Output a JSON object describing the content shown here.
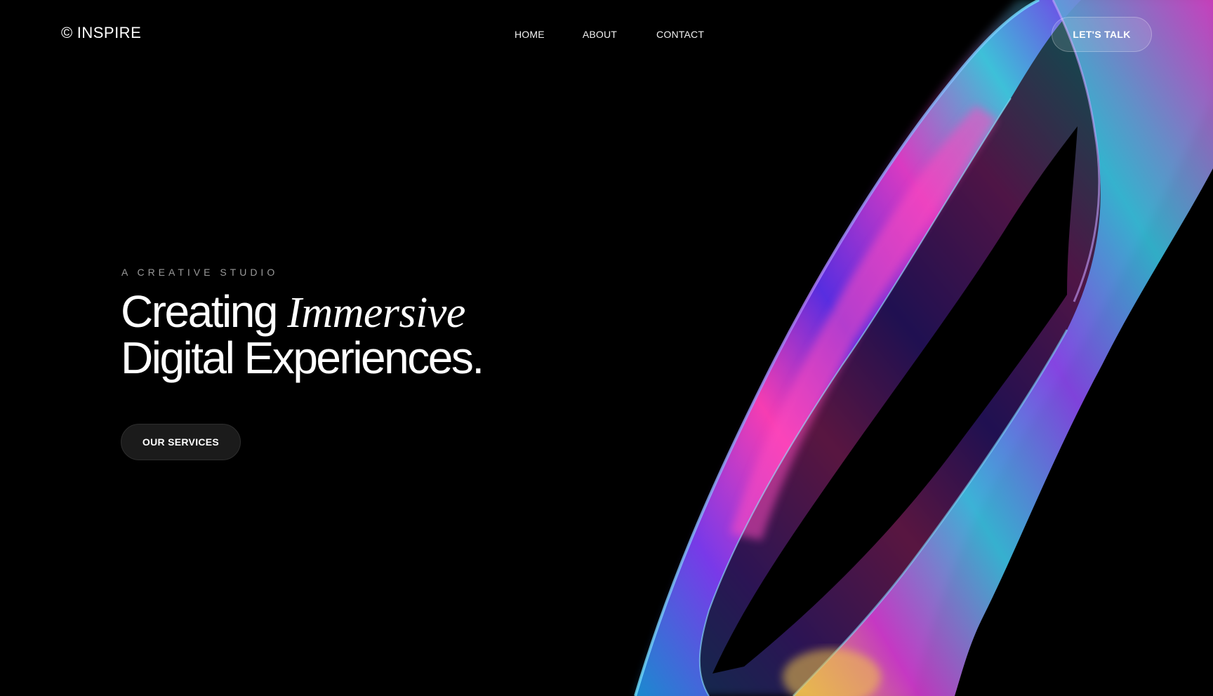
{
  "header": {
    "brand_symbol": "©",
    "brand_name": "INSPIRE",
    "nav": [
      {
        "label": "HOME"
      },
      {
        "label": "ABOUT"
      },
      {
        "label": "CONTACT"
      }
    ],
    "cta_label": "LET'S TALK"
  },
  "hero": {
    "eyebrow": "A CREATIVE STUDIO",
    "headline_part1": "Creating",
    "headline_italic": "Immersive",
    "headline_line2": "Digital Experiences.",
    "button_label": "OUR SERVICES"
  },
  "colors": {
    "background": "#000000",
    "text": "#ffffff",
    "muted": "#9a9a9a",
    "accent_magenta": "#e23cc8",
    "accent_cyan": "#3ec8e0",
    "accent_violet": "#5b2ee0"
  },
  "icons": {
    "brand": "copyright-icon"
  }
}
